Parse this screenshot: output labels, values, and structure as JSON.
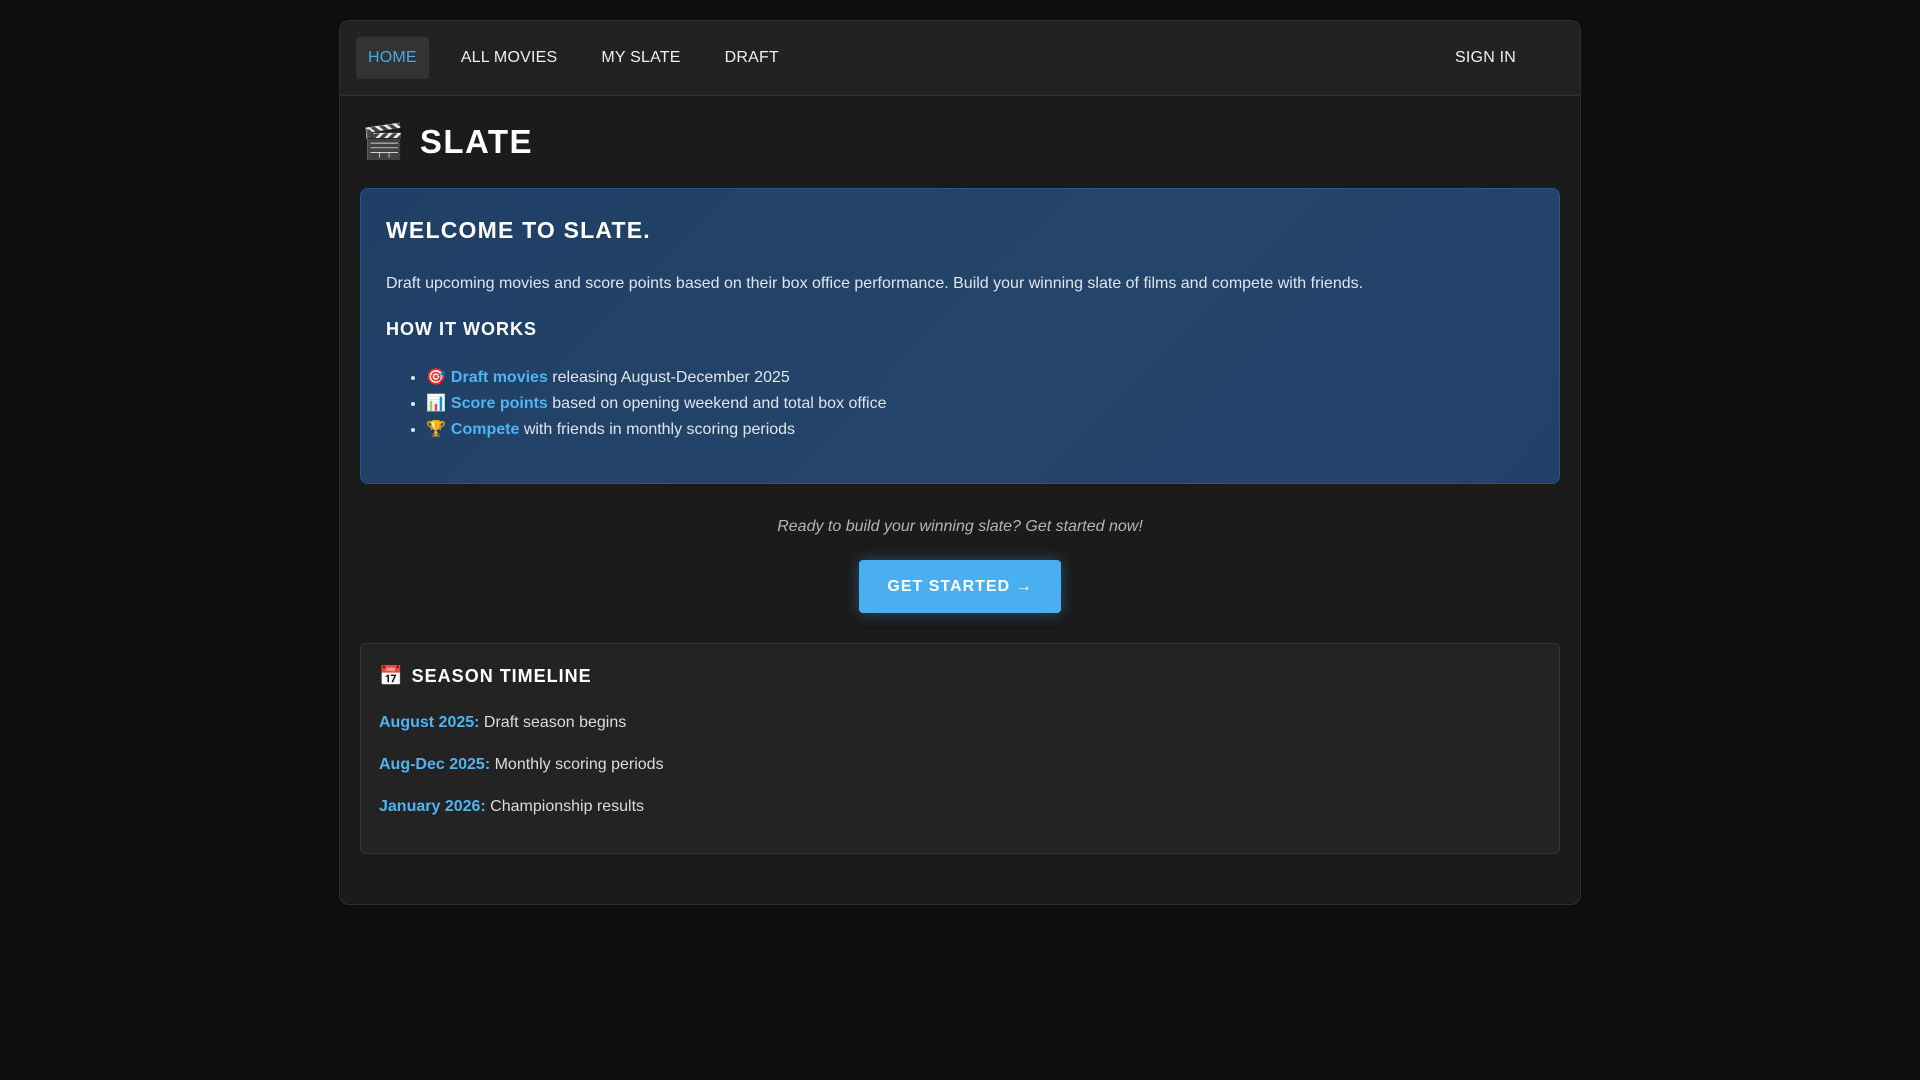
{
  "nav": {
    "items": [
      {
        "label": "HOME"
      },
      {
        "label": "ALL MOVIES"
      },
      {
        "label": "MY SLATE"
      },
      {
        "label": "DRAFT"
      }
    ],
    "signin_label": "SIGN IN"
  },
  "brand": {
    "icon": "🎬",
    "title": "SLATE"
  },
  "welcome": {
    "heading": "WELCOME TO SLATE.",
    "description": "Draft upcoming movies and score points based on their box office performance. Build your winning slate of films and compete with friends.",
    "how_heading": "HOW IT WORKS",
    "steps": [
      {
        "icon": "🎯",
        "highlight": "Draft movies",
        "text": " releasing August-December 2025"
      },
      {
        "icon": "📊",
        "highlight": "Score points",
        "text": " based on opening weekend and total box office"
      },
      {
        "icon": "🏆",
        "highlight": "Compete",
        "text": " with friends in monthly scoring periods"
      }
    ]
  },
  "cta": {
    "text": "Ready to build your winning slate? Get started now!",
    "button_label": "GET STARTED →"
  },
  "timeline": {
    "icon": "📅",
    "heading": "SEASON TIMELINE",
    "rows": [
      {
        "date": "August 2025:",
        "text": " Draft season begins"
      },
      {
        "date": "Aug-Dec 2025:",
        "text": " Monthly scoring periods"
      },
      {
        "date": "January 2026:",
        "text": " Championship results"
      }
    ]
  },
  "colors": {
    "accent": "#4aaff0",
    "background": "#0e0e0e",
    "card": "#244469"
  }
}
